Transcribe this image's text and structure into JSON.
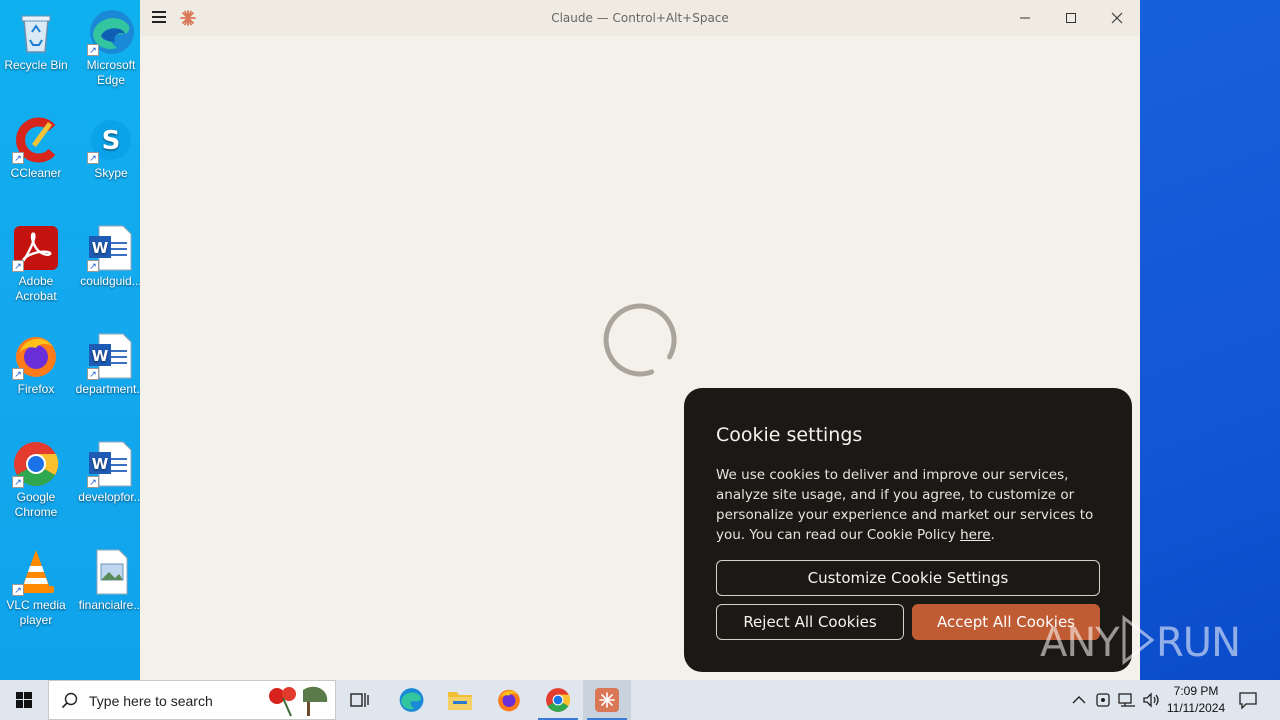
{
  "desktop": {
    "icons": [
      {
        "label": "Recycle Bin",
        "icon": "recycle-bin-icon"
      },
      {
        "label": "Microsoft Edge",
        "icon": "edge-icon"
      },
      {
        "label": "CCleaner",
        "icon": "ccleaner-icon"
      },
      {
        "label": "Skype",
        "icon": "skype-icon"
      },
      {
        "label": "Adobe Acrobat",
        "icon": "acrobat-icon"
      },
      {
        "label": "couldguid...",
        "icon": "word-doc-icon"
      },
      {
        "label": "Firefox",
        "icon": "firefox-icon"
      },
      {
        "label": "department...",
        "icon": "word-doc-icon"
      },
      {
        "label": "Google Chrome",
        "icon": "chrome-icon"
      },
      {
        "label": "developfor...",
        "icon": "word-doc-icon"
      },
      {
        "label": "VLC media player",
        "icon": "vlc-icon"
      },
      {
        "label": "financialre...",
        "icon": "image-file-icon"
      }
    ]
  },
  "window": {
    "title": "Claude — Control+Alt+Space",
    "accent": "#d97757",
    "background": "#f4f1ea"
  },
  "cookie_modal": {
    "title": "Cookie settings",
    "body": "We use cookies to deliver and improve our services, analyze site usage, and if you agree, to customize or personalize your experience and market our services to you. You can read our Cookie Policy ",
    "link_text": "here",
    "body_end": ".",
    "customize_label": "Customize Cookie Settings",
    "reject_label": "Reject All Cookies",
    "accept_label": "Accept All Cookies",
    "accept_color": "#c05c34"
  },
  "watermark": {
    "text": "ANY RUN"
  },
  "taskbar": {
    "search_placeholder": "Type here to search",
    "time": "7:09 PM",
    "date": "11/11/2024",
    "apps": [
      "task-view-icon",
      "edge-icon",
      "file-explorer-icon",
      "firefox-icon",
      "chrome-icon",
      "claude-icon"
    ]
  }
}
